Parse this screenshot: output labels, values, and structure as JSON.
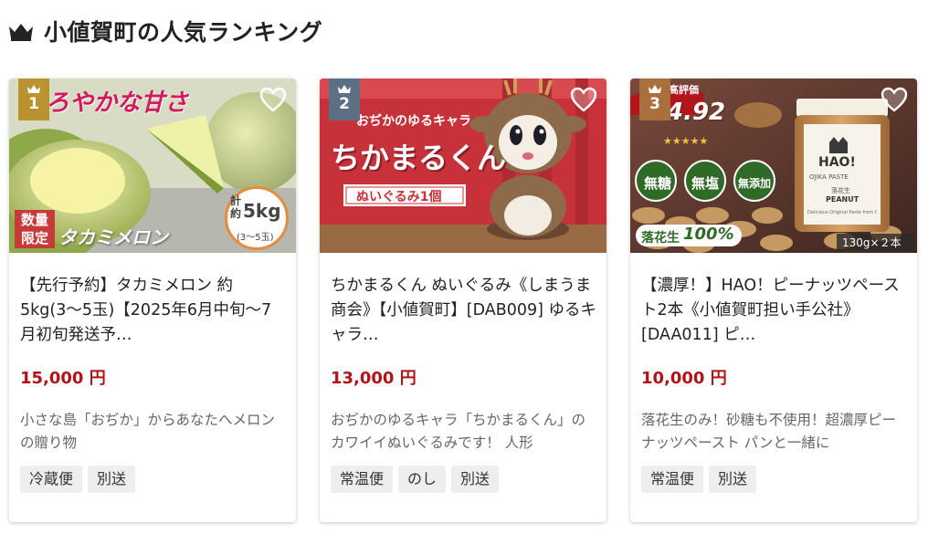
{
  "section": {
    "title": "小値賀町の人気ランキング"
  },
  "colors": {
    "price": "#b01318",
    "rank1": "#b9932f",
    "rank2": "#5d6f83",
    "rank3": "#a9703e"
  },
  "icons": {
    "heading": "crown-icon",
    "favorite": "heart-outline-icon"
  },
  "items": [
    {
      "rank": "1",
      "title": "【先行予約】タカミメロン 約5kg(3〜5玉)【2025年6月中旬〜7月初旬発送予…",
      "price": "15,000 円",
      "description": "小さな島「おぢか」からあなたへメロンの贈り物",
      "tags": [
        "冷蔵便",
        "別送"
      ],
      "image": {
        "headline": "とろやかな甘さ",
        "badge_top": "数量",
        "badge_bottom": "限定",
        "product_name": "タカミメロン",
        "weight_prefix_1": "計",
        "weight_prefix_2": "約",
        "weight": "5kg",
        "weight_note": "(3〜5玉)"
      }
    },
    {
      "rank": "2",
      "title": "ちかまるくん ぬいぐるみ《しまうま商会》【小値賀町】[DAB009] ゆるキャラ…",
      "price": "13,000 円",
      "description": "おぢかのゆるキャラ「ちかまるくん」のカワイイぬいぐるみです！ 人形",
      "tags": [
        "常温便",
        "のし",
        "別送"
      ],
      "image": {
        "tagline": "おぢかのゆるキャラ",
        "character": "ちかまるくん",
        "banner": "ぬいぐるみ1個"
      }
    },
    {
      "rank": "3",
      "title": "【濃厚！】HAO！ピーナッツペースト2本《小値賀町担い手公社》[DAA011] ピ…",
      "price": "10,000 円",
      "description": "落花生のみ！砂糖も不使用！超濃厚ピーナッツペースト パンと一緒に",
      "tags": [
        "常温便",
        "別送"
      ],
      "image": {
        "rating_label": "高評価",
        "rating": "4.92",
        "stars": "★★★★★",
        "badges": [
          "無糖",
          "無塩",
          "無添加"
        ],
        "peanut_label": "落花生",
        "peanut_pct": "100%",
        "jar_brand": "HAO!",
        "jar_sub": "OJIKA PASTE",
        "jar_jp": "落花生",
        "jar_peanut": "PEANUT",
        "jar_fine": "Delicious Original Paste from OJIKA",
        "size": "130g×２本"
      }
    }
  ]
}
